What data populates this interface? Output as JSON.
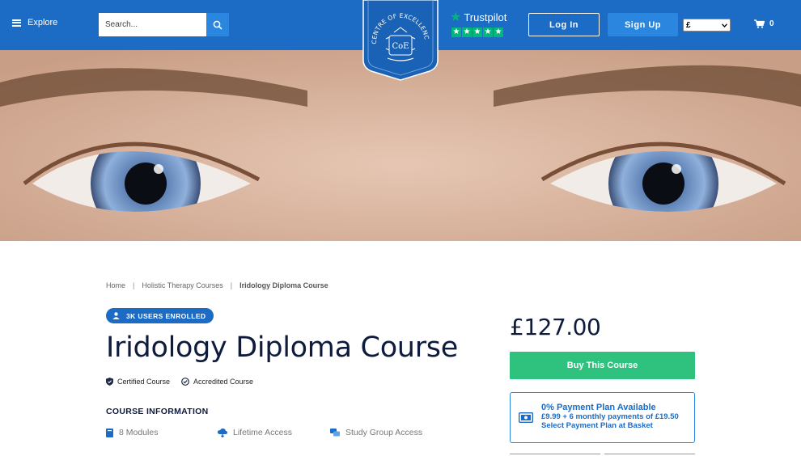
{
  "header": {
    "explore_label": "Explore",
    "search_placeholder": "Search...",
    "trustpilot_label": "Trustpilot",
    "login_label": "Log In",
    "signup_label": "Sign Up",
    "currency_value": "£",
    "cart_count": "0",
    "brand_color": "#1c6bc4",
    "logo_text": "CENTRE OF EXCELLENCE",
    "logo_mark": "CoE"
  },
  "breadcrumb": {
    "home": "Home",
    "category": "Holistic Therapy Courses",
    "current": "Iridology Diploma Course"
  },
  "course": {
    "enrolled_badge": "3K USERS ENROLLED",
    "title": "Iridology Diploma Course",
    "badge_certified": "Certified Course",
    "badge_accredited": "Accredited Course",
    "info_heading": "COURSE INFORMATION",
    "feature_modules": "8 Modules",
    "feature_access": "Lifetime Access",
    "feature_group": "Study Group Access"
  },
  "purchase": {
    "price": "£127.00",
    "buy_label": "Buy This Course",
    "buy_color": "#2ec27e",
    "plan_title": "0% Payment Plan Available",
    "plan_line1": "£9.99 + 6 monthly payments of £19.50",
    "plan_line2": "Select Payment Plan at Basket"
  }
}
